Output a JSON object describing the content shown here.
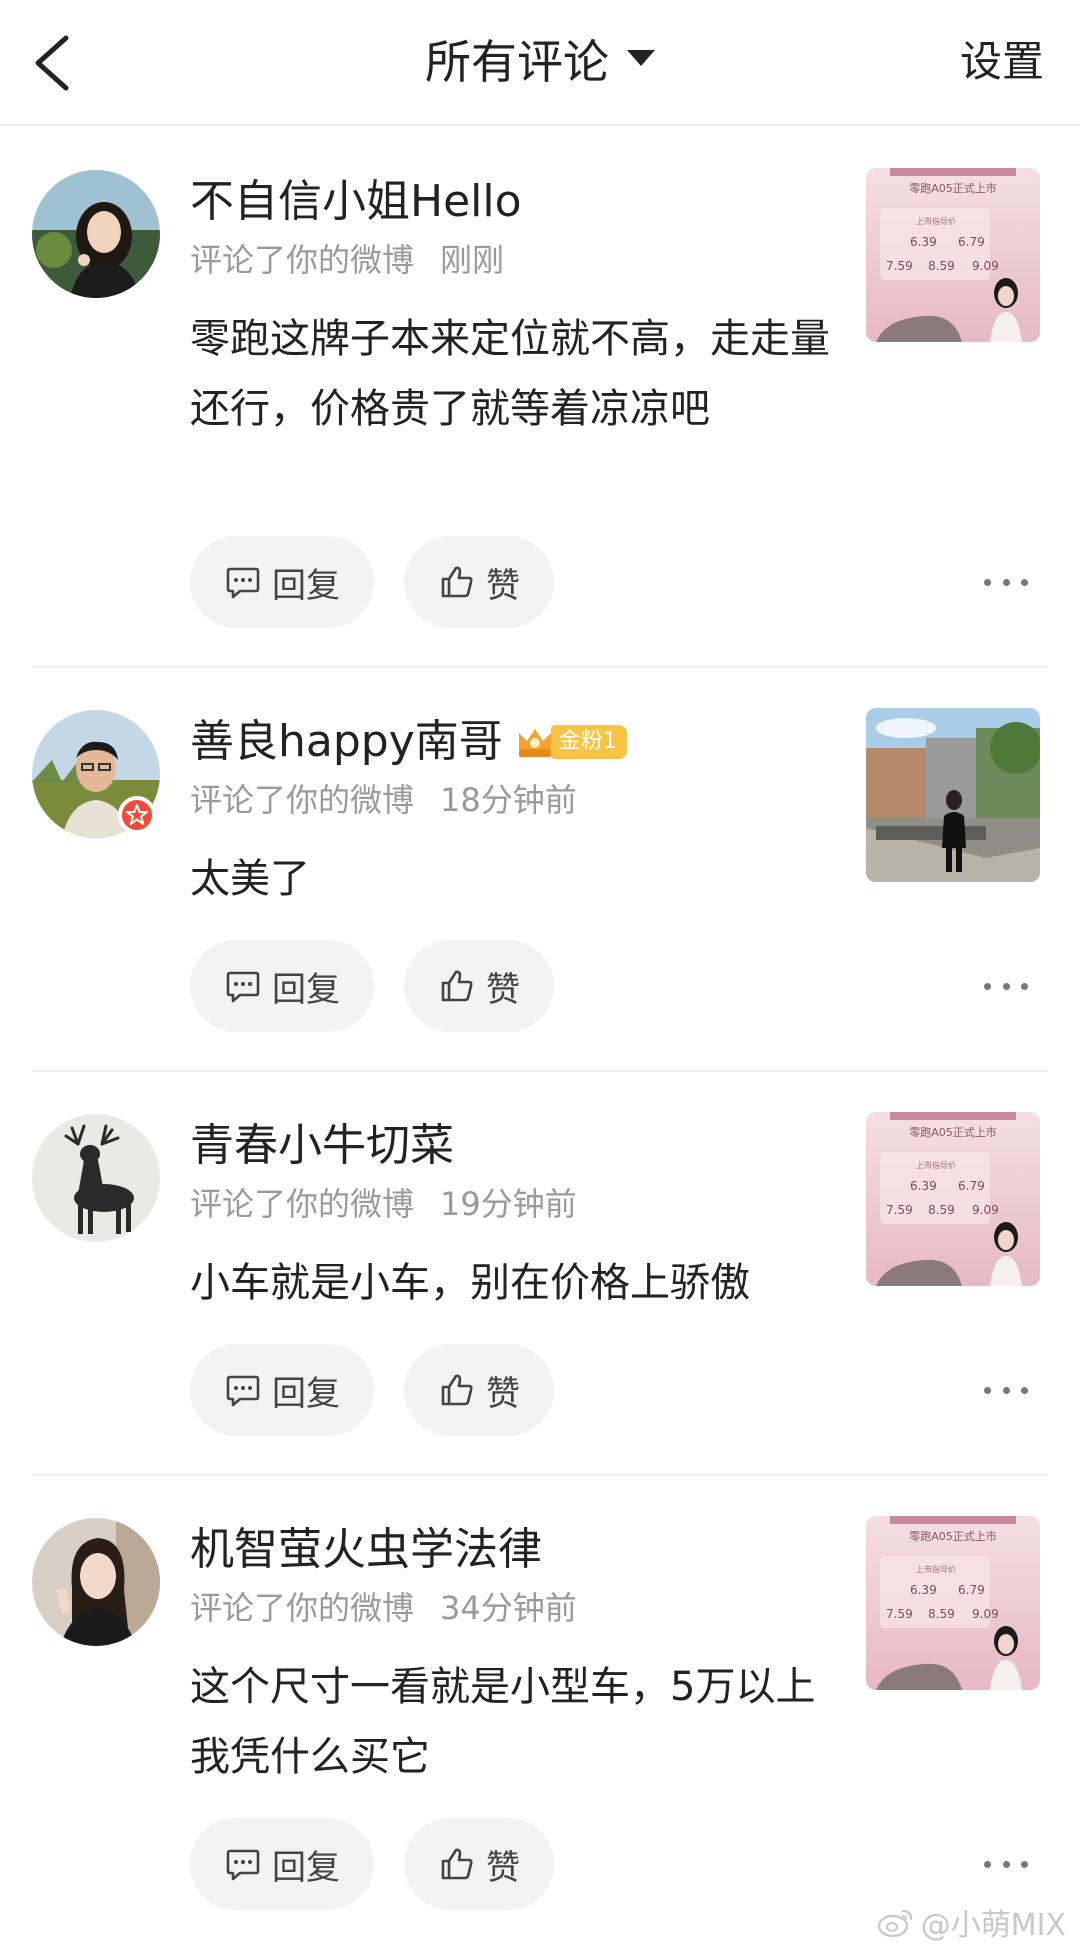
{
  "header": {
    "title": "所有评论",
    "settings_label": "设置"
  },
  "comments": [
    {
      "name": "不自信小姐Hello",
      "action": "评论了你的微博",
      "time": "刚刚",
      "text": "零跑这牌子本来定位就不高，走走量还行，价格贵了就等着凉凉吧",
      "thumb": "ad",
      "verified": false
    },
    {
      "name": "善良happy南哥",
      "fan_badge": "金粉1",
      "action": "评论了你的微博",
      "time": "18分钟前",
      "text": "太美了",
      "thumb": "photo",
      "verified": true
    },
    {
      "name": "青春小牛切菜",
      "action": "评论了你的微博",
      "time": "19分钟前",
      "text": "小车就是小车，别在价格上骄傲",
      "thumb": "ad",
      "verified": false
    },
    {
      "name": "机智萤火虫学法律",
      "action": "评论了你的微博",
      "time": "34分钟前",
      "text": "这个尺寸一看就是小型车，5万以上我凭什么买它",
      "thumb": "ad",
      "verified": false
    }
  ],
  "ad_thumb": {
    "headline": "零跑A05正式上市",
    "price_title": "上市指导价",
    "prices": [
      "6.39",
      "6.79",
      "7.59",
      "8.59",
      "9.09"
    ]
  },
  "actions": {
    "reply_label": "回复",
    "like_label": "赞"
  },
  "watermark": "@小萌MIX",
  "colors": {
    "fan_badge": "#f7c443",
    "verified_badge": "#f04a3b",
    "button_bg": "#f3f3f3",
    "meta_text": "#9a9a9a"
  }
}
